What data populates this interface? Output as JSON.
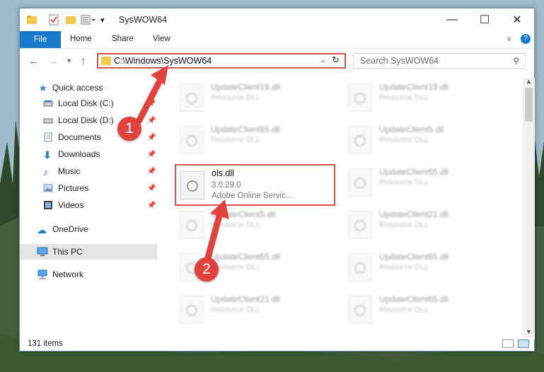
{
  "window": {
    "title": "SysWOW64"
  },
  "ribbon": {
    "file_tab": "File",
    "tabs": [
      "Home",
      "Share",
      "View"
    ]
  },
  "address": {
    "path": "C:\\Windows\\SysWOW64"
  },
  "search": {
    "placeholder": "Search SysWOW64"
  },
  "sidebar": {
    "quick_access": "Quick access",
    "items": [
      {
        "label": "Local Disk (C:)",
        "icon": "drive-icon",
        "pinned": true
      },
      {
        "label": "Local Disk (D:)",
        "icon": "drive-icon",
        "pinned": true
      },
      {
        "label": "Documents",
        "icon": "documents-icon",
        "pinned": true
      },
      {
        "label": "Downloads",
        "icon": "downloads-icon",
        "pinned": true
      },
      {
        "label": "Music",
        "icon": "music-icon",
        "pinned": true
      },
      {
        "label": "Pictures",
        "icon": "pictures-icon",
        "pinned": true
      },
      {
        "label": "Videos",
        "icon": "videos-icon",
        "pinned": true
      }
    ],
    "onedrive": "OneDrive",
    "thispc": "This PC",
    "network": "Network"
  },
  "files": {
    "left": [
      {
        "name": "UpdateClient19.dll",
        "desc": "Resource DLL"
      },
      {
        "name": "UpdateClient65.dll",
        "desc": "Resource DLL"
      },
      {
        "name": "UpdateClient5.dll",
        "desc": "Resource DLL"
      },
      {
        "name": "UpdateClient65.dll",
        "desc": "Resource DLL"
      },
      {
        "name": "UpdateClient21.dll",
        "desc": "Resource DLL"
      }
    ],
    "right": [
      {
        "name": "UpdateClient19.dll",
        "desc": "Resource DLL"
      },
      {
        "name": "UpdateClient5.dll",
        "desc": "Resource DLL"
      },
      {
        "name": "UpdateClient65.dll",
        "desc": "Resource DLL"
      },
      {
        "name": "UpdateClient21.dll",
        "desc": "Resource DLL"
      },
      {
        "name": "UpdateClient65.dll",
        "desc": "Resource DLL"
      },
      {
        "name": "UpdateClient65.dll",
        "desc": "Resource DLL"
      }
    ],
    "highlighted": {
      "name": "ols.dll",
      "version": "3.0.29.0",
      "desc": "Adobe Online Servic..."
    }
  },
  "status": {
    "count": "131 items"
  },
  "callouts": {
    "one": "1",
    "two": "2"
  },
  "colors": {
    "accent": "#1979ca",
    "highlight": "#d9534f"
  }
}
